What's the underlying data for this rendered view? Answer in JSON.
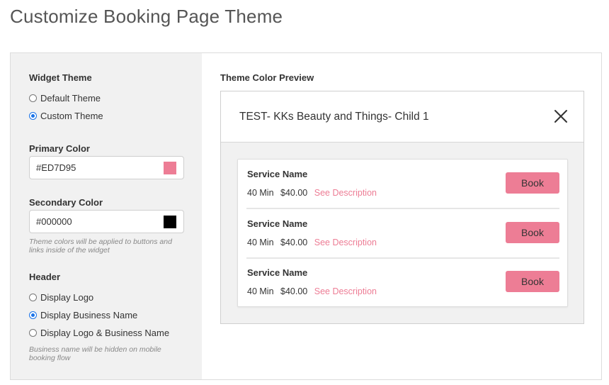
{
  "page": {
    "title": "Customize Booking Page Theme"
  },
  "widget_theme": {
    "label": "Widget Theme",
    "options": [
      {
        "label": "Default Theme",
        "checked": false
      },
      {
        "label": "Custom Theme",
        "checked": true
      }
    ]
  },
  "primary_color": {
    "label": "Primary Color",
    "value": "#ED7D95",
    "swatch": "#ED7D95"
  },
  "secondary_color": {
    "label": "Secondary Color",
    "value": "#000000",
    "swatch": "#000000"
  },
  "theme_hint": "Theme colors will be applied to buttons and links inside of the widget",
  "header": {
    "label": "Header",
    "options": [
      {
        "label": "Display Logo",
        "checked": false
      },
      {
        "label": "Display Business Name",
        "checked": true
      },
      {
        "label": "Display Logo & Business Name",
        "checked": false
      }
    ],
    "hint": "Business name will be hidden on mobile booking flow"
  },
  "preview": {
    "label": "Theme Color Preview",
    "business_name": "TEST- KKs Beauty and Things- Child 1",
    "close_icon": "close-icon",
    "services": [
      {
        "name": "Service Name",
        "duration": "40 Min",
        "price": "$40.00",
        "link": "See Description",
        "button": "Book"
      },
      {
        "name": "Service Name",
        "duration": "40 Min",
        "price": "$40.00",
        "link": "See Description",
        "button": "Book"
      },
      {
        "name": "Service Name",
        "duration": "40 Min",
        "price": "$40.00",
        "link": "See Description",
        "button": "Book"
      }
    ]
  },
  "colors": {
    "accent": "#ED7D95",
    "link": "#ED7D95",
    "panel_bg": "#F1F1F1"
  }
}
